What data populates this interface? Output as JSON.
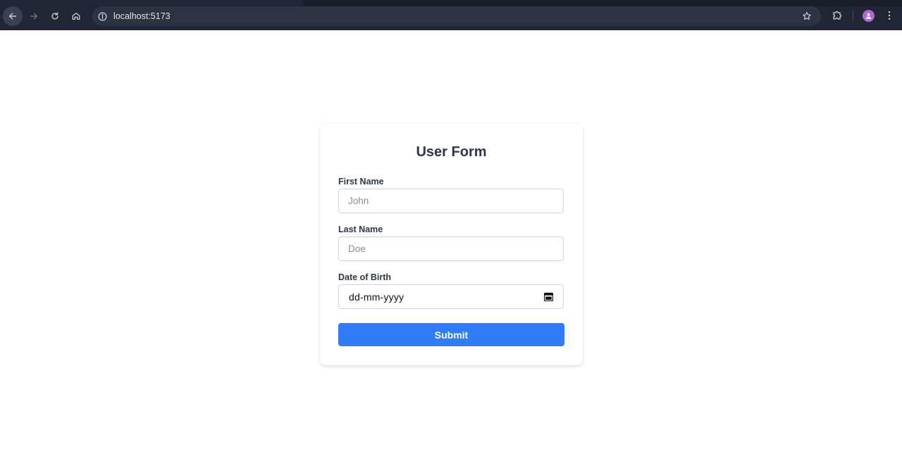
{
  "browser": {
    "url": "localhost:5173"
  },
  "form": {
    "title": "User Form",
    "first_name": {
      "label": "First Name",
      "placeholder": "John",
      "value": ""
    },
    "last_name": {
      "label": "Last Name",
      "placeholder": "Doe",
      "value": ""
    },
    "date_of_birth": {
      "label": "Date of Birth",
      "display": "dd-mm-yyyy"
    },
    "submit_label": "Submit"
  },
  "icons": {
    "back": "arrow-left-icon",
    "forward": "arrow-right-icon",
    "reload": "reload-icon",
    "home": "home-icon",
    "site_info": "info-icon",
    "bookmark": "star-icon",
    "extensions": "puzzle-icon",
    "profile": "avatar",
    "menu": "kebab-menu-icon",
    "calendar": "calendar-icon"
  },
  "colors": {
    "chrome_bg": "#202634",
    "omnibox_bg": "#2c3342",
    "accent": "#2f7cf6",
    "title_text": "#2d3748",
    "profile": "#b364d6"
  }
}
